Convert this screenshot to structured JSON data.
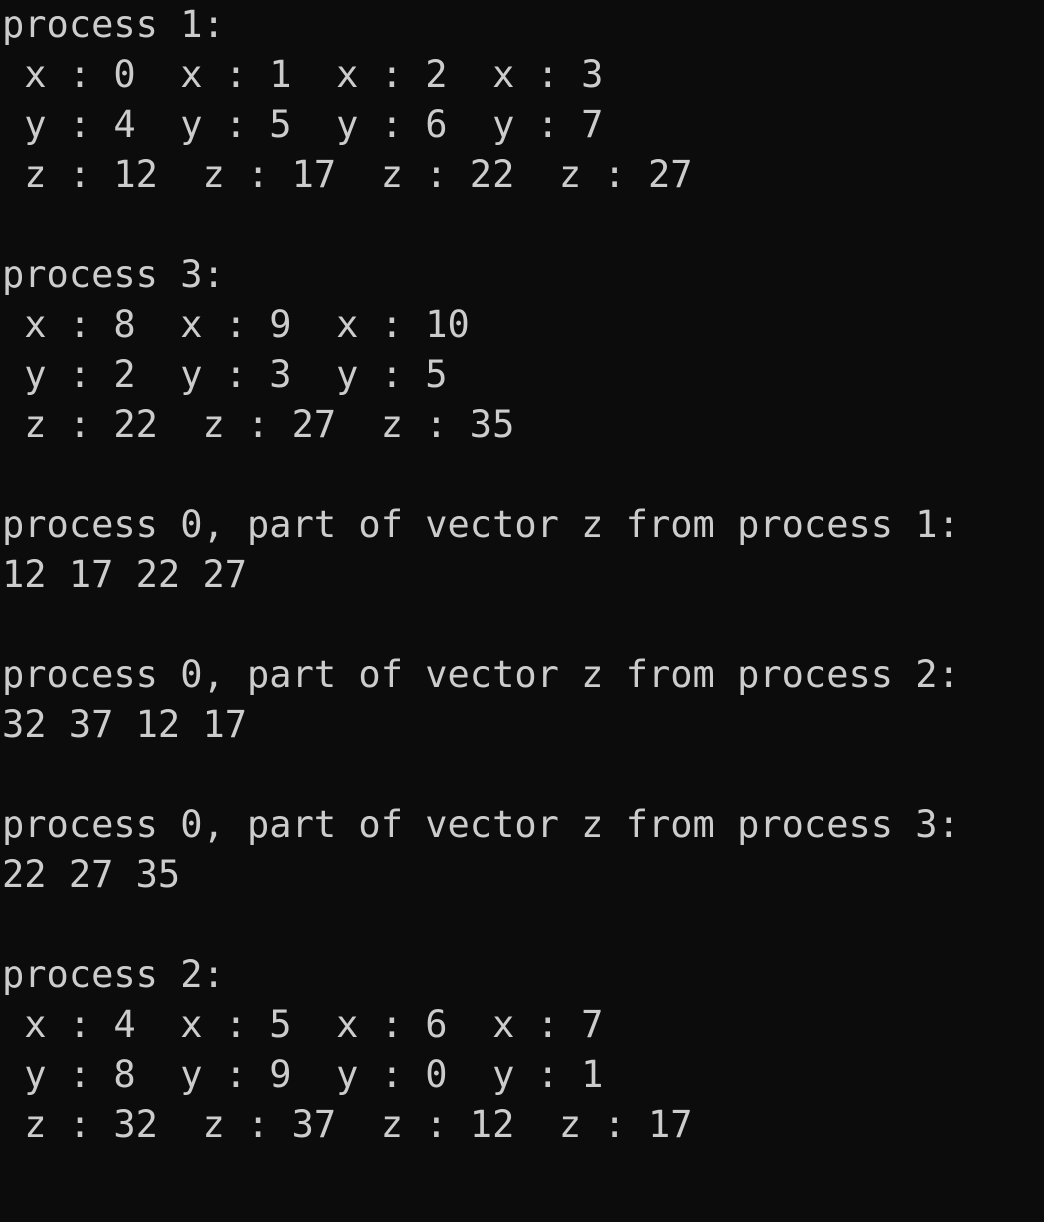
{
  "console": {
    "background": "#0c0c0c",
    "foreground": "#cccccc",
    "lines": [
      "process 1:",
      " x : 0  x : 1  x : 2  x : 3",
      " y : 4  y : 5  y : 6  y : 7",
      " z : 12  z : 17  z : 22  z : 27",
      "",
      "process 3:",
      " x : 8  x : 9  x : 10",
      " y : 2  y : 3  y : 5",
      " z : 22  z : 27  z : 35",
      "",
      "process 0, part of vector z from process 1:",
      "12 17 22 27",
      "",
      "process 0, part of vector z from process 2:",
      "32 37 12 17",
      "",
      "process 0, part of vector z from process 3:",
      "22 27 35",
      "",
      "process 2:",
      " x : 4  x : 5  x : 6  x : 7",
      " y : 8  y : 9  y : 0  y : 1",
      " z : 32  z : 37  z : 12  z : 17"
    ]
  }
}
